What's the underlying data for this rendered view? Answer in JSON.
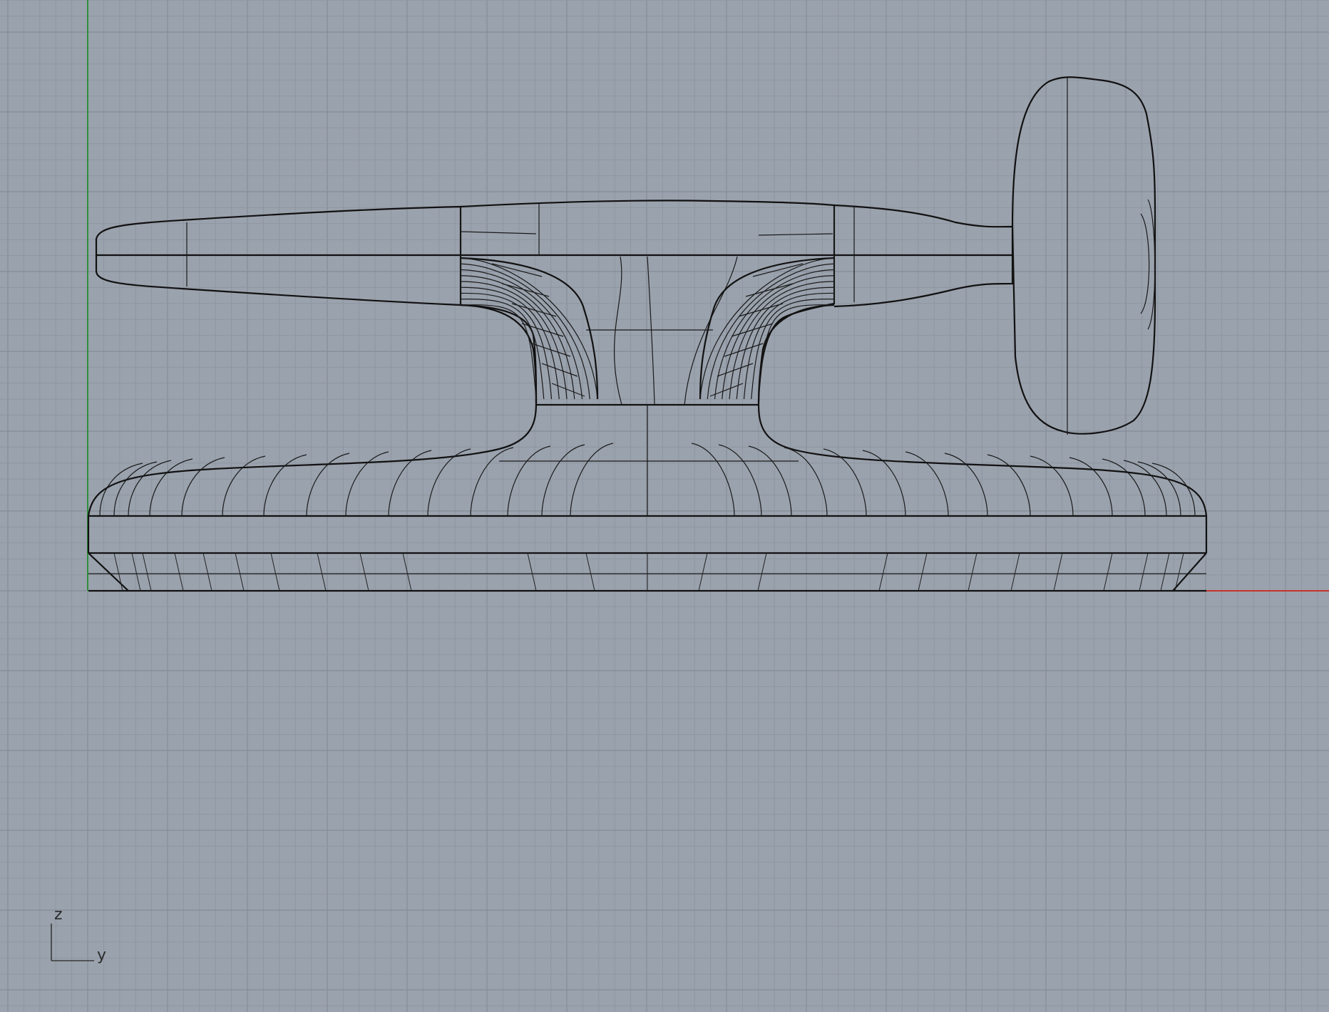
{
  "viewport": {
    "background": "#9aa2ad",
    "grid_color": "#8e96a1",
    "x_axis_color": "#c8332b",
    "y_axis_color": "#2f8f3c",
    "object_color": "#111111"
  },
  "axis_widget": {
    "vertical_label": "z",
    "horizontal_label": "y"
  }
}
